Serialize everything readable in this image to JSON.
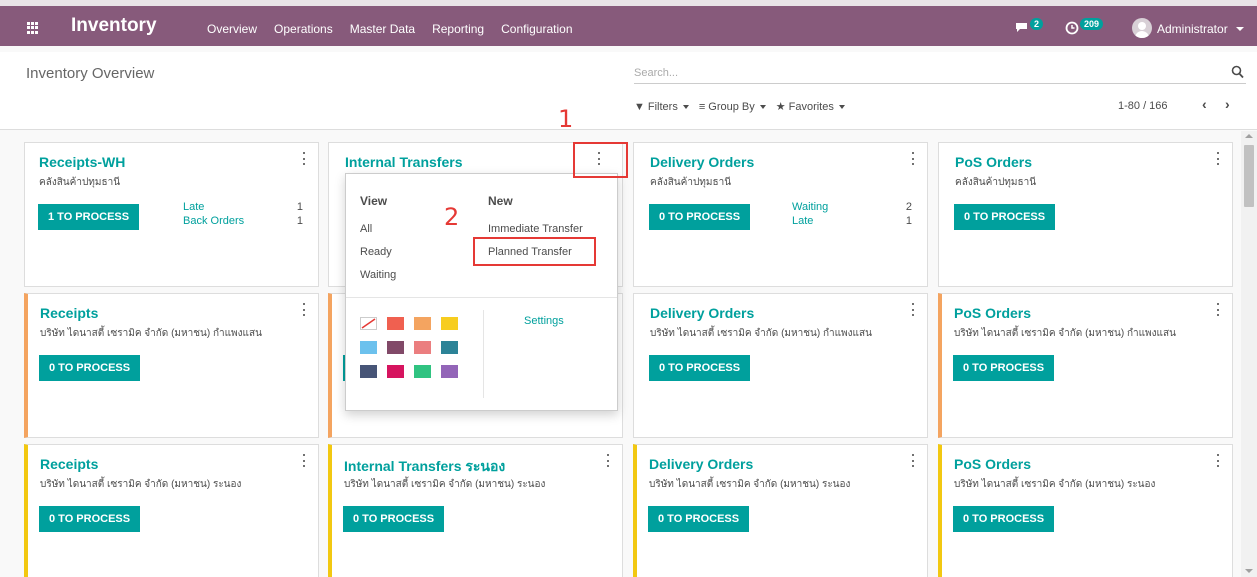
{
  "navbar": {
    "app_name": "Inventory",
    "menu": [
      "Overview",
      "Operations",
      "Master Data",
      "Reporting",
      "Configuration"
    ],
    "chat_count": "2",
    "activity_count": "209",
    "user": "Administrator"
  },
  "control": {
    "title": "Inventory Overview",
    "search_placeholder": "Search...",
    "filters": "Filters",
    "group_by": "Group By",
    "favorites": "Favorites",
    "pager": "1-80 / 166"
  },
  "cards": [
    {
      "title": "Receipts-WH",
      "sub": "คลังสินค้าปทุมธานี",
      "button": "1 TO PROCESS",
      "stats": [
        {
          "label": "Late",
          "value": "1"
        },
        {
          "label": "Back Orders",
          "value": "1"
        }
      ]
    },
    {
      "title": "Internal Transfers",
      "sub": "",
      "button": "",
      "stats": []
    },
    {
      "title": "Delivery Orders",
      "sub": "คลังสินค้าปทุมธานี",
      "button": "0 TO PROCESS",
      "stats": [
        {
          "label": "Waiting",
          "value": "2"
        },
        {
          "label": "Late",
          "value": "1"
        }
      ]
    },
    {
      "title": "PoS Orders",
      "sub": "คลังสินค้าปทุมธานี",
      "button": "0 TO PROCESS",
      "stats": []
    },
    {
      "title": "Receipts",
      "sub": "บริษัท ไดนาสตี้ เซรามิค จำกัด (มหาชน) กำแพงแสน",
      "button": "0 TO PROCESS",
      "stats": []
    },
    {
      "title": "",
      "sub": "",
      "button": "",
      "stats": []
    },
    {
      "title": "Delivery Orders",
      "sub": "บริษัท ไดนาสตี้ เซรามิค จำกัด (มหาชน) กำแพงแสน",
      "button": "0 TO PROCESS",
      "stats": []
    },
    {
      "title": "PoS Orders",
      "sub": "บริษัท ไดนาสตี้ เซรามิค จำกัด (มหาชน) กำแพงแสน",
      "button": "0 TO PROCESS",
      "stats": []
    },
    {
      "title": "Receipts",
      "sub": "บริษัท ไดนาสตี้ เซรามิค จำกัด (มหาชน) ระนอง",
      "button": "0 TO PROCESS",
      "stats": []
    },
    {
      "title": "Internal Transfers ระนอง",
      "sub": "บริษัท ไดนาสตี้ เซรามิค จำกัด (มหาชน) ระนอง",
      "button": "0 TO PROCESS",
      "stats": []
    },
    {
      "title": "Delivery Orders",
      "sub": "บริษัท ไดนาสตี้ เซรามิค จำกัด (มหาชน) ระนอง",
      "button": "0 TO PROCESS",
      "stats": []
    },
    {
      "title": "PoS Orders",
      "sub": "บริษัท ไดนาสตี้ เซรามิค จำกัด (มหาชน) ระนอง",
      "button": "0 TO PROCESS",
      "stats": []
    }
  ],
  "dropdown": {
    "view_header": "View",
    "view_items": [
      "All",
      "Ready",
      "Waiting"
    ],
    "new_header": "New",
    "new_items": [
      "Immediate Transfer",
      "Planned Transfer"
    ],
    "settings": "Settings",
    "colors": [
      "none",
      "#f06050",
      "#f4a460",
      "#f7cd1f",
      "#6cc1ed",
      "#814968",
      "#eb7e7f",
      "#2c8397",
      "#475577",
      "#d6145f",
      "#30c381",
      "#9365b8"
    ]
  },
  "annotations": [
    "1",
    "2"
  ],
  "accent_color": "#00a09d",
  "navbar_color": "#875a7b"
}
